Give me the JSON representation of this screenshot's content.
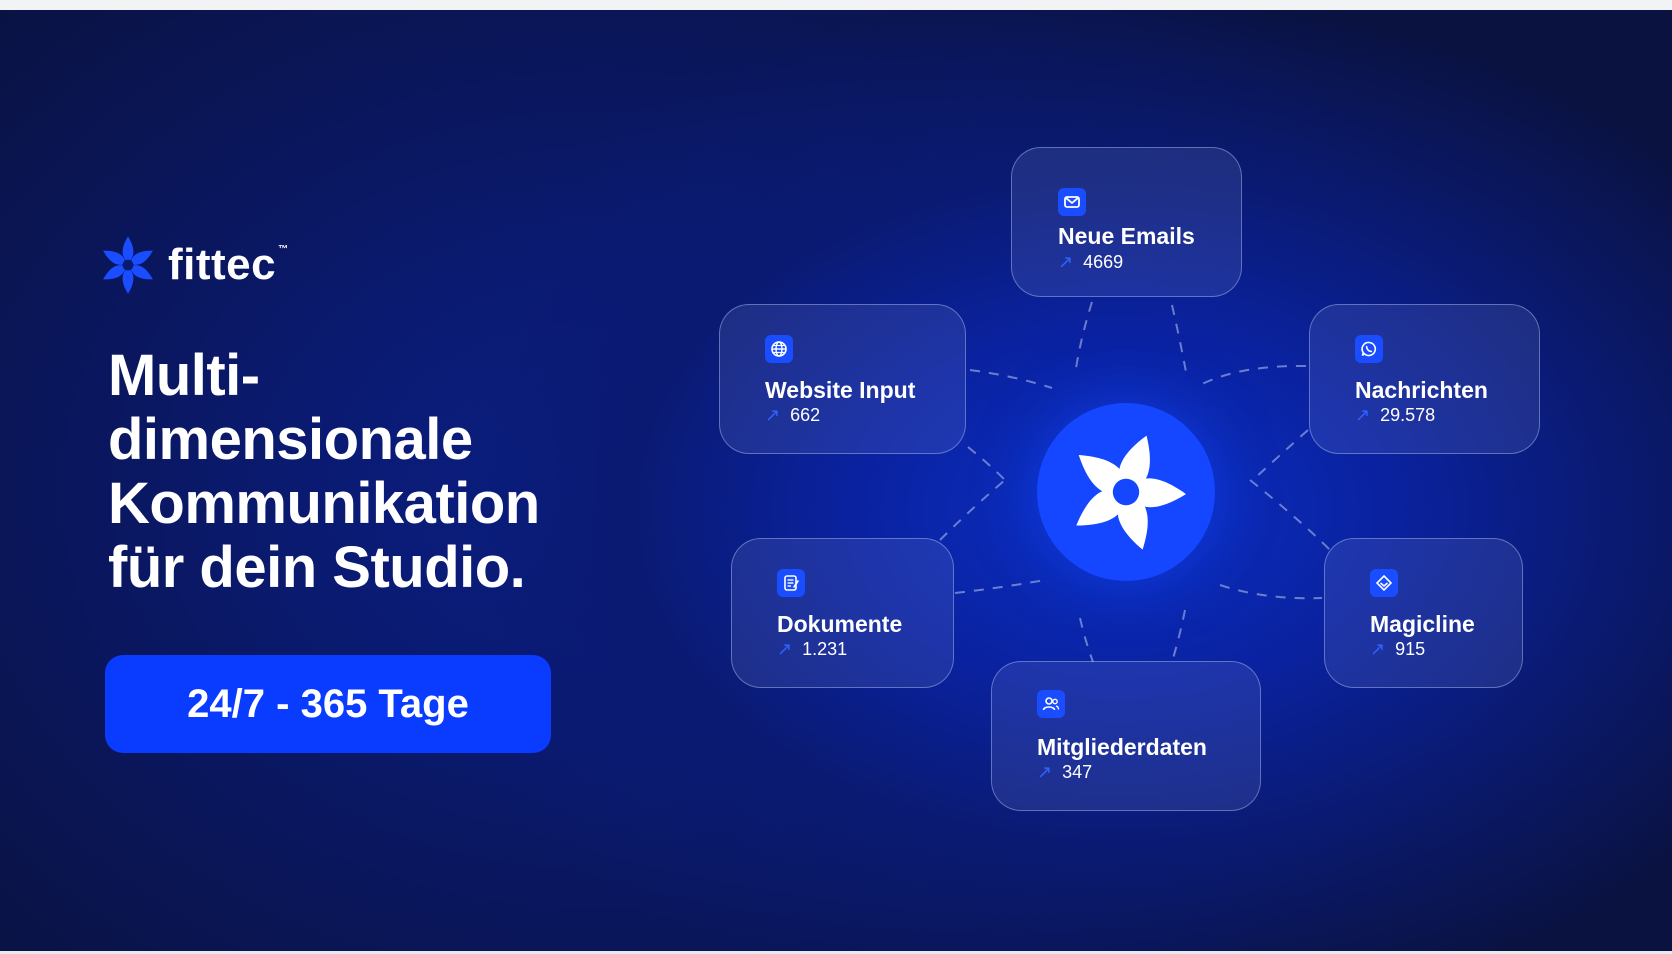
{
  "brand": {
    "name": "fittec",
    "tm": "™",
    "accent": "#1447ff",
    "background": "#0a1240",
    "icon": "fittec-star-logo-icon"
  },
  "headline": {
    "lines": [
      "Multi-",
      "dimensionale",
      "Kommunikation",
      "für dein Studio."
    ]
  },
  "cta": {
    "label": "24/7 - 365 Tage"
  },
  "hub": {
    "icon": "fittec-star-logo-icon"
  },
  "channels": {
    "emails": {
      "title": "Neue Emails",
      "value": "4669",
      "icon": "mail-icon"
    },
    "website": {
      "title": "Website Input",
      "value": "662",
      "icon": "globe-icon"
    },
    "messages": {
      "title": "Nachrichten",
      "value": "29.578",
      "icon": "whatsapp-icon"
    },
    "docs": {
      "title": "Dokumente",
      "value": "1.231",
      "icon": "document-icon"
    },
    "magicline": {
      "title": "Magicline",
      "value": "915",
      "icon": "magicline-icon"
    },
    "members": {
      "title": "Mitgliederdaten",
      "value": "347",
      "icon": "users-icon"
    }
  },
  "trend_icon": "arrow-up-right-icon"
}
